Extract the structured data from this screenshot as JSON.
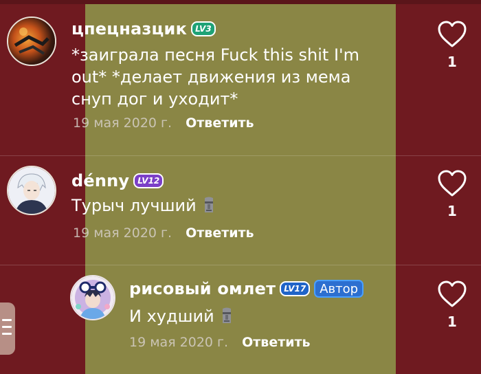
{
  "comments": [
    {
      "username": "цпецназцик",
      "level": "LV3",
      "text": "*заиграла песня Fuck this shit I'm out* *делает движения из мема снуп дог и уходит*",
      "date": "19 мая 2020 г.",
      "reply_label": "Ответить",
      "likes": "1"
    },
    {
      "username": "dénny",
      "level": "LV12",
      "text": "Турыч лучший",
      "emoji": "moai-icon",
      "date": "19 мая 2020 г.",
      "reply_label": "Ответить",
      "likes": "1"
    },
    {
      "username": "рисовый омлет",
      "level": "LV17",
      "badge": "Автор",
      "text": "И худший",
      "emoji": "moai-icon",
      "date": "19 мая 2020 г.",
      "reply_label": "Ответить",
      "likes": "1"
    }
  ],
  "colors": {
    "background": "#6f1a20",
    "center_band": "#8a8645",
    "lv3": "#1fa276",
    "lv12": "#7b3fc7",
    "lv17": "#1f64c8",
    "author_badge": "#2c6fd0"
  }
}
